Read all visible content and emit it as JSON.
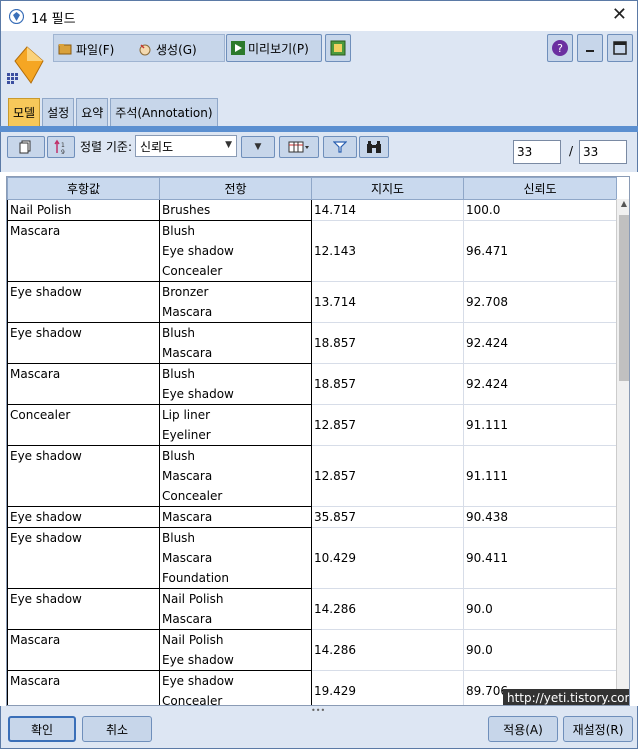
{
  "window": {
    "title": "14 필드",
    "close_glyph": "✕"
  },
  "menu": {
    "file": "파일(F)",
    "generate": "생성(G)",
    "preview": "미리보기(P)"
  },
  "tabs": [
    "모델",
    "설정",
    "요약",
    "주석(Annotation)"
  ],
  "toolbar": {
    "sort_label": "정렬 기준:",
    "sort_value": "신뢰도",
    "page_current": "33",
    "page_sep": "/",
    "page_total": "33"
  },
  "table": {
    "headers": [
      "후항값",
      "전항",
      "지지도",
      "신뢰도"
    ],
    "rows": [
      {
        "consequent": "Nail Polish",
        "antecedents": [
          "Brushes"
        ],
        "support": "14.714",
        "confidence": "100.0"
      },
      {
        "consequent": "Mascara",
        "antecedents": [
          "Blush",
          "Eye shadow",
          "Concealer"
        ],
        "support": "12.143",
        "confidence": "96.471"
      },
      {
        "consequent": "Eye shadow",
        "antecedents": [
          "Bronzer",
          "Mascara"
        ],
        "support": "13.714",
        "confidence": "92.708"
      },
      {
        "consequent": "Eye shadow",
        "antecedents": [
          "Blush",
          "Mascara"
        ],
        "support": "18.857",
        "confidence": "92.424"
      },
      {
        "consequent": "Mascara",
        "antecedents": [
          "Blush",
          "Eye shadow"
        ],
        "support": "18.857",
        "confidence": "92.424"
      },
      {
        "consequent": "Concealer",
        "antecedents": [
          "Lip liner",
          "Eyeliner"
        ],
        "support": "12.857",
        "confidence": "91.111"
      },
      {
        "consequent": "Eye shadow",
        "antecedents": [
          "Blush",
          "Mascara",
          "Concealer"
        ],
        "support": "12.857",
        "confidence": "91.111"
      },
      {
        "consequent": "Eye shadow",
        "antecedents": [
          "Mascara"
        ],
        "support": "35.857",
        "confidence": "90.438"
      },
      {
        "consequent": "Eye shadow",
        "antecedents": [
          "Blush",
          "Mascara",
          "Foundation"
        ],
        "support": "10.429",
        "confidence": "90.411"
      },
      {
        "consequent": "Eye shadow",
        "antecedents": [
          "Nail Polish",
          "Mascara"
        ],
        "support": "14.286",
        "confidence": "90.0"
      },
      {
        "consequent": "Mascara",
        "antecedents": [
          "Nail Polish",
          "Eye shadow"
        ],
        "support": "14.286",
        "confidence": "90.0"
      },
      {
        "consequent": "Mascara",
        "antecedents": [
          "Eye shadow",
          "Concealer"
        ],
        "support": "19.429",
        "confidence": "89.706"
      }
    ]
  },
  "watermark": "http://yeti.tistory.com",
  "buttons": {
    "ok": "확인",
    "cancel": "취소",
    "apply": "적용(A)",
    "reset": "재설정(R)"
  },
  "colors": {
    "active_tab": "#f7c85a",
    "panel": "#dde6f3",
    "header": "#c9d9ee",
    "accent_line": "#5b8fd0"
  }
}
